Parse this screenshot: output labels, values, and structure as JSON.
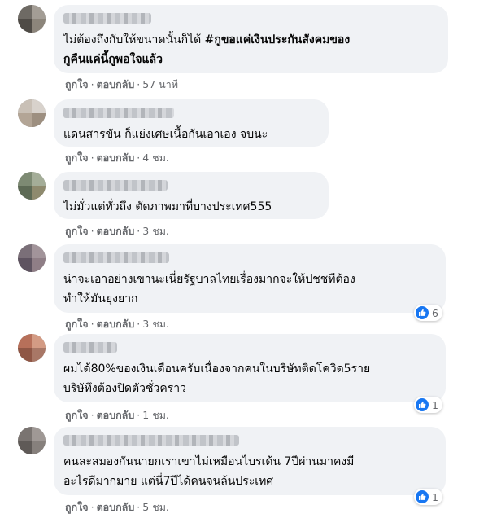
{
  "comments": [
    {
      "text_parts": [
        "ไม่ต้องถึงกับให้ขนาดนั้นก็ได้ ",
        "#กูขอแค่เงินประกันสังคมของ\nกูคืนแค่นี้กูพอใจแล้ว"
      ],
      "like": "ถูกใจ",
      "reply": "ตอบกลับ",
      "time": "57 นาที",
      "reactions": ""
    },
    {
      "text": "แดนสารขัน ก็แย่งเศษเนื้อกันเอาเอง จบนะ",
      "like": "ถูกใจ",
      "reply": "ตอบกลับ",
      "time": "4 ชม.",
      "reactions": ""
    },
    {
      "text": "ไม่มั่วแต่ทั่วถึง ตัดภาพมาที่บางประเทศ555",
      "like": "ถูกใจ",
      "reply": "ตอบกลับ",
      "time": "3 ชม.",
      "reactions": ""
    },
    {
      "text": "น่าจะเอาอย่างเขานะเนี่ยรัฐบาลไทยเรื่องมากจะให้ปชชทีต้อง\nทำให้มันยุ่งยาก",
      "like": "ถูกใจ",
      "reply": "ตอบกลับ",
      "time": "3 ชม.",
      "reactions": "6"
    },
    {
      "text": "ผมได้80%ของเงินเดือนครับเนื่องจากคนในบริษัทติดโควิด5ราย\nบริษัทึงต้องปิดตัวชั่วคราว",
      "like": "ถูกใจ",
      "reply": "ตอบกลับ",
      "time": "1 ชม.",
      "reactions": "1"
    },
    {
      "text": "คนละสมองกันนายกเราเขาไม่เหมือนไบรเด้น 7ปีผ่านมาคงมี\nอะไรดีมากมาย แต่นี่7ปีได้คนจนล้นประเทศ",
      "like": "ถูกใจ",
      "reply": "ตอบกลับ",
      "time": "5 ชม.",
      "reactions": "1"
    }
  ],
  "separator": "·",
  "colors": {
    "bubble": "#f0f2f5",
    "meta_text": "#65676b",
    "like_blue": "#1877f2"
  },
  "icons": {
    "reaction": "like-thumb-icon"
  }
}
